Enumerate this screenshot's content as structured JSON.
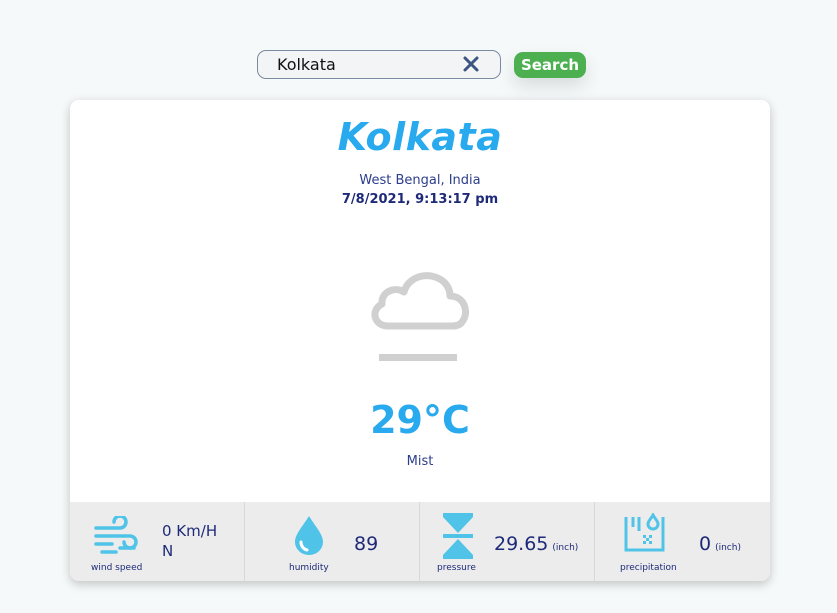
{
  "search": {
    "value": "Kolkata",
    "button_label": "Search"
  },
  "location": {
    "city": "Kolkata",
    "region": "West Bengal, India",
    "datetime": "7/8/2021, 9:13:17 pm"
  },
  "current": {
    "temperature": "29°C",
    "condition": "Mist",
    "icon": "mist-icon"
  },
  "stats": {
    "wind": {
      "value": "0 Km/H",
      "direction": "N",
      "label": "wind speed",
      "icon": "wind-icon"
    },
    "humidity": {
      "value": "89",
      "label": "humidity",
      "icon": "droplet-icon"
    },
    "pressure": {
      "value": "29.65",
      "unit": "(inch)",
      "label": "pressure",
      "icon": "pressure-icon"
    },
    "precipitation": {
      "value": "0",
      "unit": "(inch)",
      "label": "precipitation",
      "icon": "precipitation-icon"
    }
  },
  "colors": {
    "accent": "#29a9ee",
    "text": "#1e2a78",
    "icon": "#4fc3e8",
    "button": "#4caf50"
  }
}
